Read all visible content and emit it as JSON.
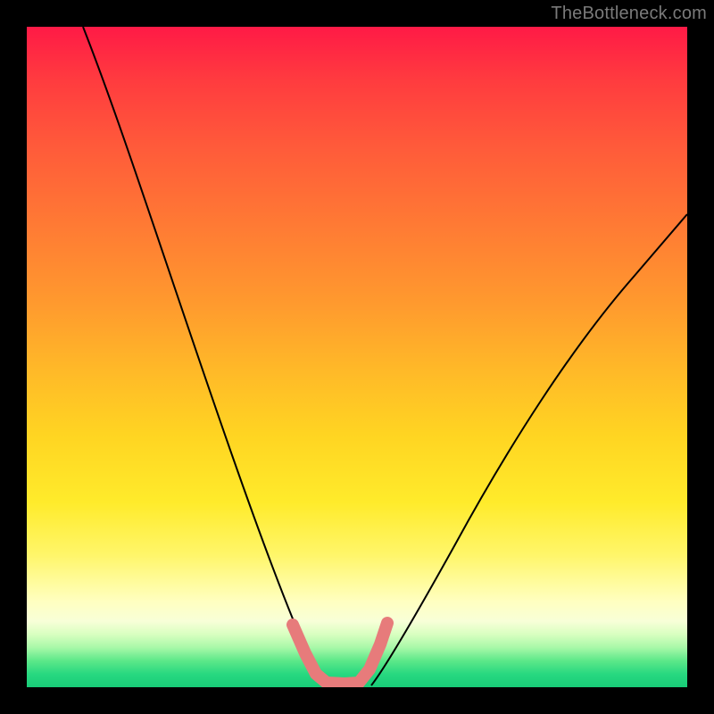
{
  "watermark": "TheBottleneck.com",
  "chart_data": {
    "type": "line",
    "title": "",
    "xlabel": "",
    "ylabel": "",
    "xlim": [
      0,
      100
    ],
    "ylim": [
      0,
      100
    ],
    "background_gradient": {
      "top": "#ff1a46",
      "upper_mid": "#ff9a2e",
      "mid": "#ffeb2b",
      "lower": "#5ce889",
      "bottom": "#18cc78"
    },
    "series": [
      {
        "name": "left-curve",
        "x": [
          9,
          15,
          20,
          25,
          30,
          34,
          37,
          40,
          42,
          44,
          45.5
        ],
        "y": [
          100,
          82,
          68,
          54,
          40,
          28,
          18,
          10,
          5,
          2,
          0.5
        ],
        "stroke": "#000000"
      },
      {
        "name": "right-curve",
        "x": [
          52,
          55,
          60,
          66,
          72,
          78,
          84,
          90,
          95,
          100
        ],
        "y": [
          0.5,
          4,
          12,
          22,
          33,
          44,
          54,
          62,
          68,
          72
        ],
        "stroke": "#000000"
      },
      {
        "name": "bottom-marker",
        "x": [
          40,
          42,
          44,
          46,
          48,
          50,
          52,
          54
        ],
        "y": [
          8,
          4,
          1.2,
          0.6,
          0.6,
          1,
          4,
          8
        ],
        "stroke": "#e77b7b"
      }
    ],
    "annotations": [
      {
        "text": "TheBottleneck.com",
        "position": "top-right",
        "color": "#7a7a7a"
      }
    ]
  }
}
